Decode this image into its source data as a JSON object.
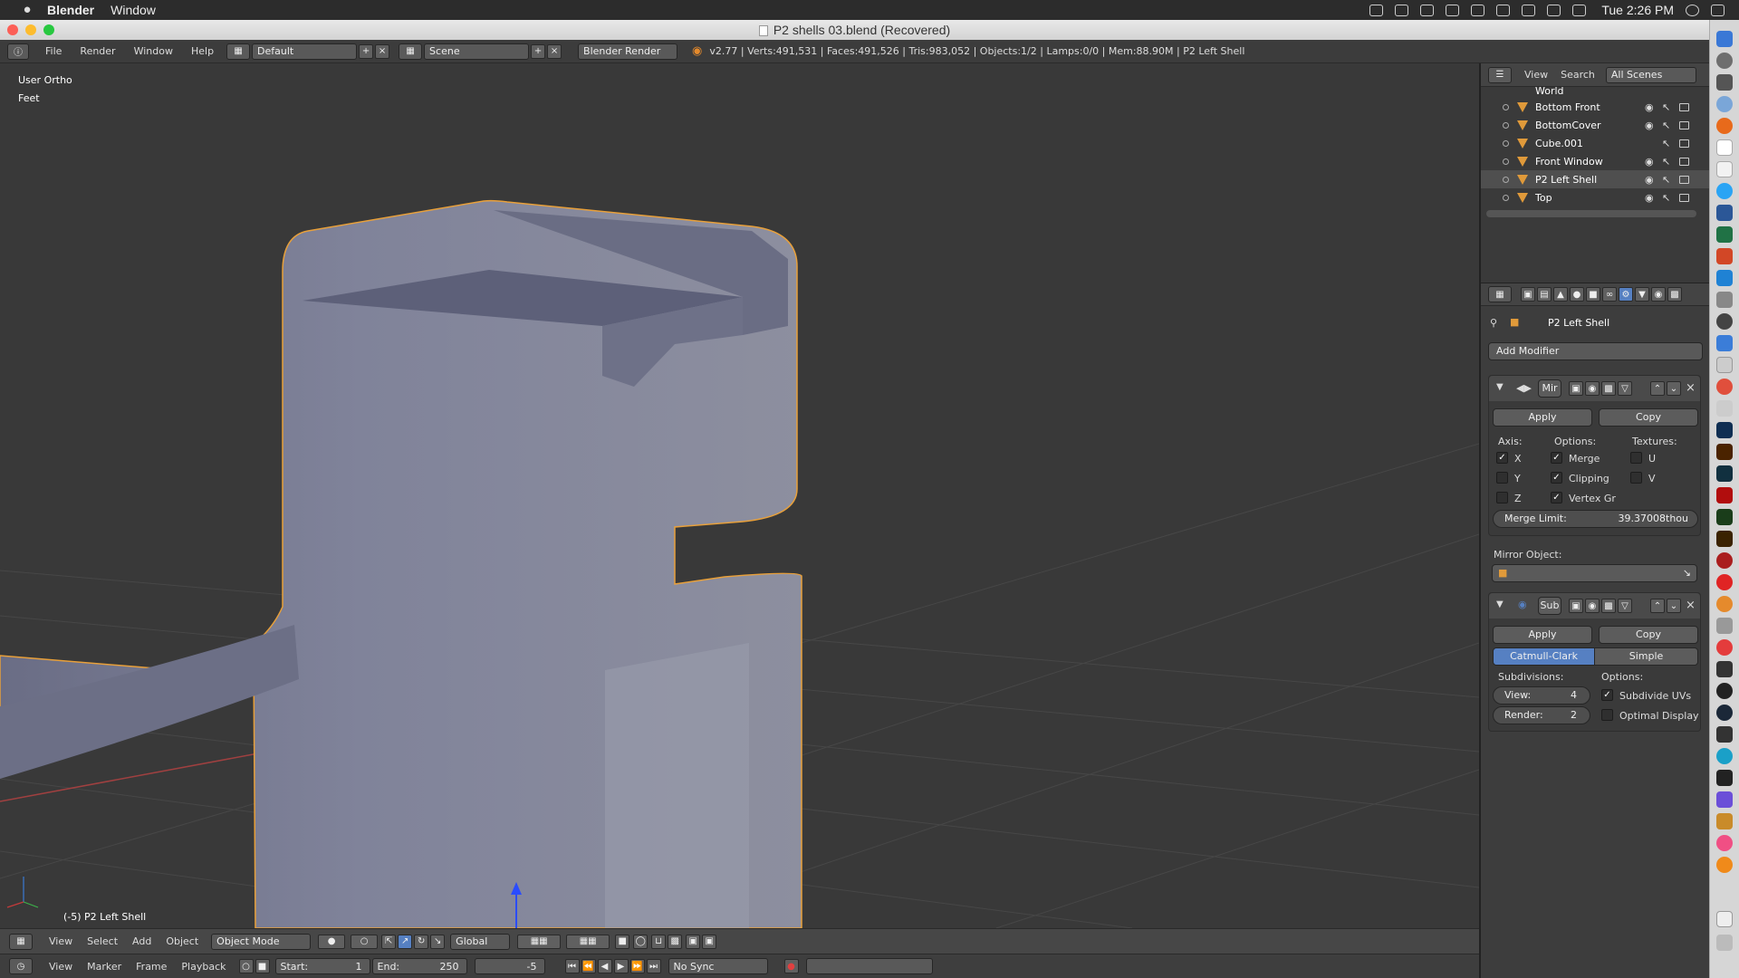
{
  "menubar": {
    "app_name": "Blender",
    "menus": [
      "Window"
    ],
    "clock": "Tue 2:26 PM"
  },
  "window": {
    "title": "P2 shells 03.blend (Recovered)"
  },
  "info_header": {
    "menus": [
      "File",
      "Render",
      "Window",
      "Help"
    ],
    "layout": "Default",
    "scene": "Scene",
    "engine": "Blender Render",
    "stats": "v2.77 | Verts:491,531 | Faces:491,526 | Tris:983,052 | Objects:1/2 | Lamps:0/0 | Mem:88.90M | P2 Left Shell"
  },
  "viewport": {
    "view_name": "User Ortho",
    "units": "Feet",
    "object_info": "(-5) P2 Left Shell",
    "header": {
      "menus": [
        "View",
        "Select",
        "Add",
        "Object"
      ],
      "mode": "Object Mode",
      "orientation": "Global"
    }
  },
  "timeline": {
    "menus": [
      "View",
      "Marker",
      "Frame",
      "Playback"
    ],
    "start_label": "Start:",
    "start_value": "1",
    "end_label": "End:",
    "end_value": "250",
    "current_frame": "-5",
    "sync": "No Sync"
  },
  "outliner": {
    "menus": [
      "View",
      "Search"
    ],
    "filter": "All Scenes",
    "items": [
      {
        "label": "World"
      },
      {
        "label": "Bottom Front"
      },
      {
        "label": "BottomCover"
      },
      {
        "label": "Cube.001"
      },
      {
        "label": "Front Window"
      },
      {
        "label": "P2 Left Shell"
      },
      {
        "label": "Top"
      }
    ]
  },
  "properties": {
    "object_name": "P2 Left Shell",
    "add_modifier": "Add Modifier",
    "mirror": {
      "name": "Mir",
      "apply": "Apply",
      "copy": "Copy",
      "axis_label": "Axis:",
      "options_label": "Options:",
      "textures_label": "Textures:",
      "axis": [
        {
          "label": "X",
          "checked": true
        },
        {
          "label": "Y",
          "checked": false
        },
        {
          "label": "Z",
          "checked": false
        }
      ],
      "options": [
        {
          "label": "Merge",
          "checked": true
        },
        {
          "label": "Clipping",
          "checked": true
        },
        {
          "label": "Vertex Gr",
          "checked": true
        }
      ],
      "textures": [
        {
          "label": "U",
          "checked": false
        },
        {
          "label": "V",
          "checked": false
        }
      ],
      "merge_limit_label": "Merge Limit:",
      "merge_limit_value": "39.37008thou",
      "mirror_object_label": "Mirror Object:"
    },
    "subsurf": {
      "name": "Sub",
      "apply": "Apply",
      "copy": "Copy",
      "tab_catmull": "Catmull-Clark",
      "tab_simple": "Simple",
      "subdivisions_label": "Subdivisions:",
      "options_label": "Options:",
      "view_label": "View:",
      "view_value": "4",
      "render_label": "Render:",
      "render_value": "2",
      "subdivide_uvs": {
        "label": "Subdivide UVs",
        "checked": true
      },
      "optimal_display": {
        "label": "Optimal Display",
        "checked": false
      }
    }
  },
  "colors": {
    "accent_blue": "#5680c2",
    "selection_orange": "#e8a03a",
    "mesh_color": "#7a7d94"
  }
}
